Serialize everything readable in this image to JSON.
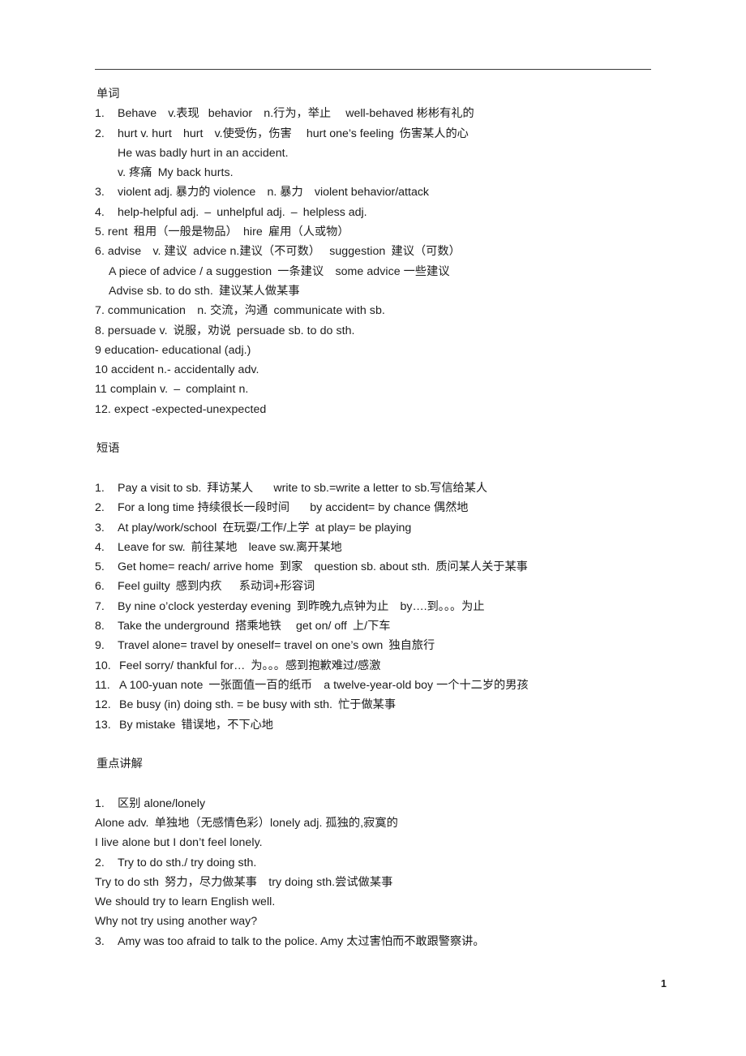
{
  "document": {
    "page_number": "1",
    "sections": [
      {
        "heading": "单词",
        "items": [
          {
            "style": "list",
            "num": "1.",
            "text": "Behave v.表现  behavior n.行为，举止  well-behaved 彬彬有礼的"
          },
          {
            "style": "list",
            "num": "2.",
            "text": "hurt v. hurt hurt v.使受伤，伤害  hurt one’s feeling 伤害某人的心"
          },
          {
            "style": "indent1",
            "text": "He was badly hurt in an accident."
          },
          {
            "style": "indent1",
            "text": "v. 疼痛 My back hurts."
          },
          {
            "style": "list",
            "num": "3.",
            "text": "violent adj. 暴力的 violence n. 暴力 violent behavior/attack"
          },
          {
            "style": "list",
            "num": "4.",
            "text": "help-helpful adj. – unhelpful adj. – helpless adj."
          },
          {
            "style": "plain",
            "text": "5. rent 租用（一般是物品） hire 雇用（人或物）"
          },
          {
            "style": "plain",
            "text": "6. advise v. 建议 advice n.建议（不可数）  suggestion 建议（可数）"
          },
          {
            "style": "indent2",
            "text": "A piece of advice / a suggestion 一条建议 some advice 一些建议"
          },
          {
            "style": "indent2",
            "text": "Advise sb. to do sth. 建议某人做某事"
          },
          {
            "style": "plain",
            "text": "7. communication n. 交流，沟通 communicate with sb."
          },
          {
            "style": "plain",
            "text": "8. persuade v. 说服，劝说 persuade sb. to do sth."
          },
          {
            "style": "plain",
            "text": "9 education- educational (adj.)"
          },
          {
            "style": "plain",
            "text": "10 accident n.- accidentally adv."
          },
          {
            "style": "plain",
            "text": "11 complain v. – complaint n."
          },
          {
            "style": "plain",
            "text": "12. expect -expected-unexpected"
          }
        ]
      },
      {
        "heading": "短语",
        "items": [
          {
            "style": "list",
            "num": "1.",
            "text": "Pay a visit to sb. 拜访某人   write to sb.=write a letter to sb.写信给某人"
          },
          {
            "style": "list",
            "num": "2.",
            "text": "For a long time 持续很长一段时间   by accident= by chance 偶然地"
          },
          {
            "style": "list",
            "num": "3.",
            "text": "At play/work/school 在玩耍/工作/上学 at play= be playing"
          },
          {
            "style": "list",
            "num": "4.",
            "text": "Leave for sw. 前往某地 leave sw.离开某地"
          },
          {
            "style": "list",
            "num": "5.",
            "text": "Get home= reach/ arrive home 到家 question sb. about sth. 质问某人关于某事"
          },
          {
            "style": "list",
            "num": "6.",
            "text": "Feel guilty 感到内疚  系动词+形容词"
          },
          {
            "style": "list",
            "num": "7.",
            "text": "By nine o’clock yesterday evening 到昨晚九点钟为止 by….到。。。为止"
          },
          {
            "style": "list",
            "num": "8.",
            "text": "Take the underground 搭乘地铁  get on/ off 上/下车"
          },
          {
            "style": "list",
            "num": "9.",
            "text": "Travel alone= travel by oneself= travel on one’s own 独自旅行"
          },
          {
            "style": "list",
            "num": "10.",
            "text": "Feel sorry/ thankful for… 为。。。感到抱歉难过/感激"
          },
          {
            "style": "list",
            "num": "11.",
            "text": "A 100-yuan note 一张面值一百的纸币 a twelve-year-old boy 一个十二岁的男孩"
          },
          {
            "style": "list",
            "num": "12.",
            "text": "Be busy (in) doing sth. = be busy with sth. 忙于做某事"
          },
          {
            "style": "list",
            "num": "13.",
            "text": "By mistake 错误地，不下心地"
          }
        ]
      },
      {
        "heading": "重点讲解",
        "items": [
          {
            "style": "list",
            "num": "1.",
            "text": "区别 alone/lonely"
          },
          {
            "style": "plain",
            "text": "Alone adv. 单独地（无感情色彩）lonely adj. 孤独的,寂寞的"
          },
          {
            "style": "plain",
            "text": "I live alone but I don’t feel lonely."
          },
          {
            "style": "list",
            "num": "2.",
            "text": "Try to do sth./ try doing sth."
          },
          {
            "style": "plain",
            "text": "Try to do sth 努力，尽力做某事 try doing sth.尝试做某事"
          },
          {
            "style": "plain",
            "text": "We should try to learn English well."
          },
          {
            "style": "plain",
            "text": "Why not try using another way?"
          },
          {
            "style": "list",
            "num": "3.",
            "text": "Amy was too afraid to talk to the police. Amy 太过害怕而不敢跟警察讲。"
          }
        ]
      }
    ]
  }
}
